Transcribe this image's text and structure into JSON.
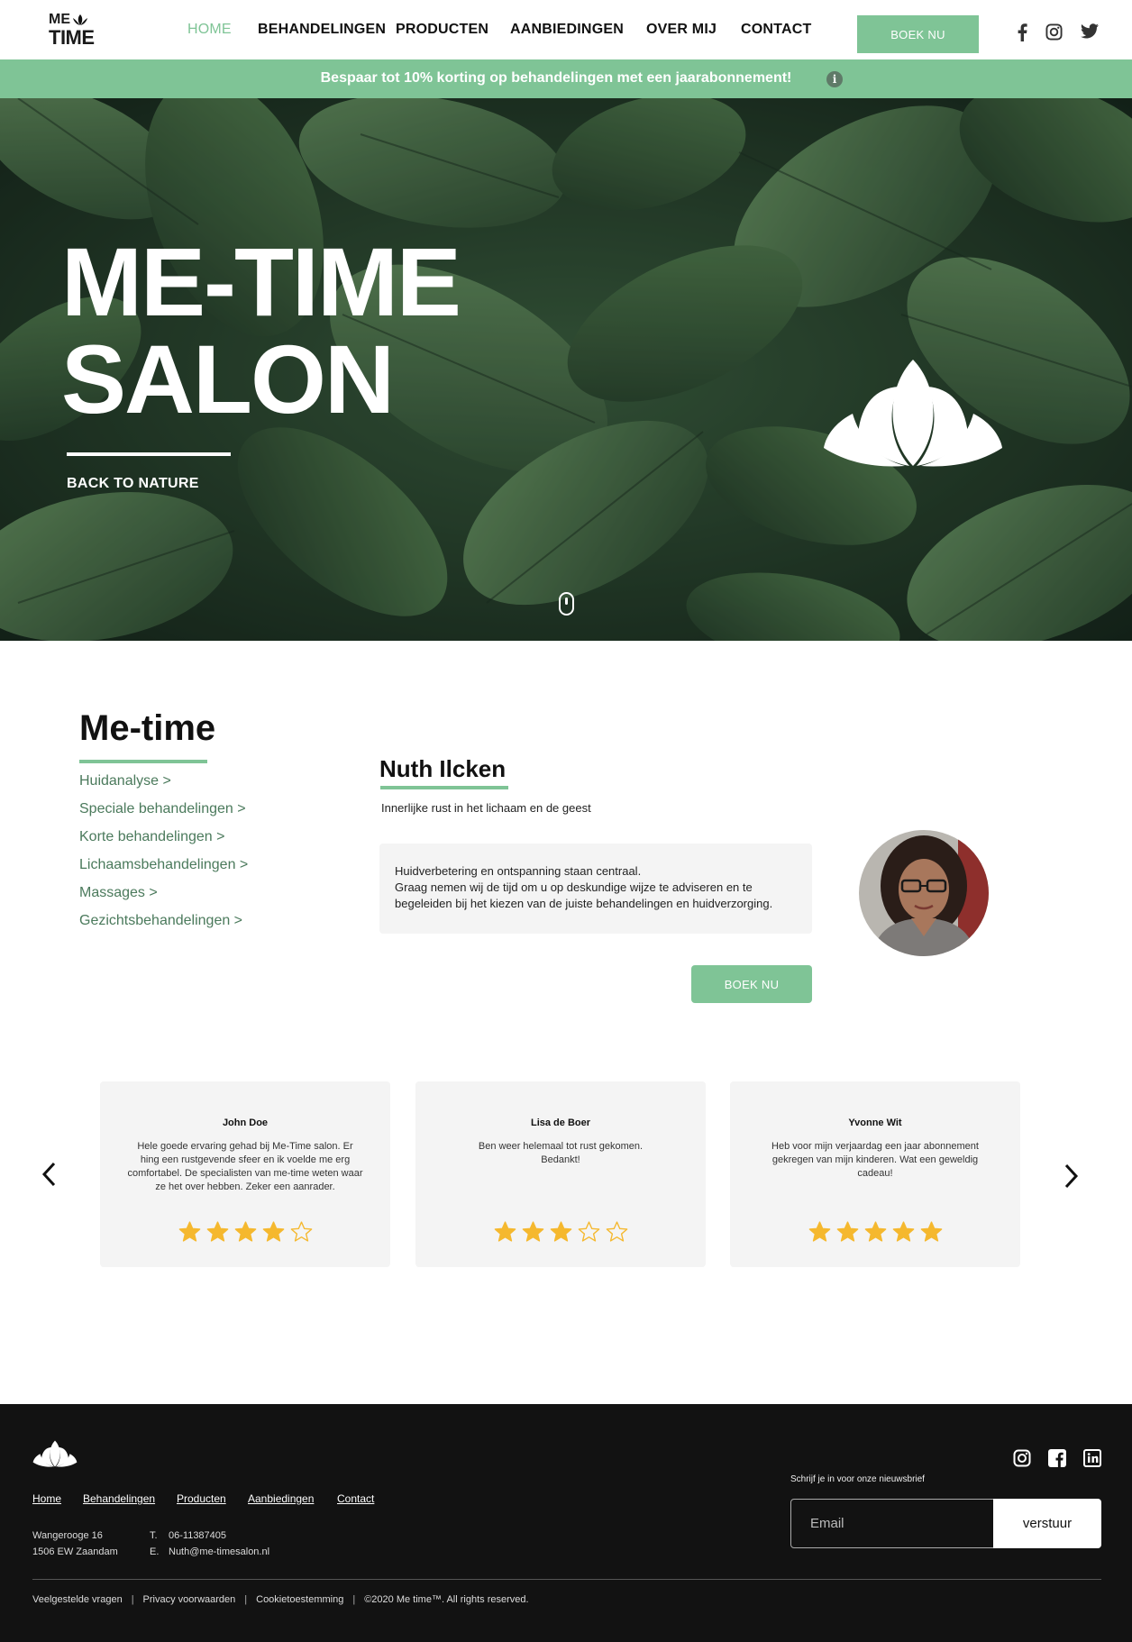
{
  "header": {
    "logo": {
      "line1": "ME",
      "line2": "TIME",
      "icon": "lotus-icon"
    },
    "nav": [
      {
        "label": "HOME",
        "active": true
      },
      {
        "label": "BEHANDELINGEN",
        "active": false
      },
      {
        "label": "PRODUCTEN",
        "active": false
      },
      {
        "label": "AANBIEDINGEN",
        "active": false
      },
      {
        "label": "OVER MIJ",
        "active": false
      },
      {
        "label": "CONTACT",
        "active": false
      }
    ],
    "book_label": "BOEK NU",
    "social_icons": [
      "facebook-icon",
      "instagram-icon",
      "twitter-icon"
    ]
  },
  "promo": {
    "text": "Bespaar tot 10% korting op behandelingen met een jaarabonnement!",
    "info_glyph": "i"
  },
  "hero": {
    "title_line1": "ME-TIME",
    "title_line2": "SALON",
    "tagline": "BACK TO NATURE",
    "icons": [
      "lotus-icon",
      "scroll-mouse-icon"
    ]
  },
  "metime": {
    "title": "Me-time",
    "categories": [
      "Huidanalyse  >",
      "Speciale behandelingen >",
      "Korte behandelingen >",
      "Lichaamsbehandelingen >",
      "Massages >",
      "Gezichtsbehandelingen  >"
    ]
  },
  "profile": {
    "name": "Nuth Ilcken",
    "subtitle": "Innerlijke rust in het lichaam en de geest",
    "bio_line1": "Huidverbetering en ontspanning staan centraal.",
    "bio_line2": "Graag nemen wij de tijd om u op deskundige wijze te adviseren en te begeleiden bij het kiezen van de juiste behandelingen en huidverzorging.",
    "book_label": "BOEK NU"
  },
  "reviews": [
    {
      "name": "John Doe",
      "text": "Hele goede ervaring gehad bij Me-Time salon. Er hing een rustgevende sfeer en ik voelde me erg comfortabel. De specialisten van me-time weten waar ze het over hebben. Zeker een aanrader.",
      "rating": 4
    },
    {
      "name": "Lisa de Boer",
      "text": "Ben weer helemaal tot rust gekomen. Bedankt!",
      "rating": 3
    },
    {
      "name": "Yvonne Wit",
      "text": "Heb voor mijn verjaardag een jaar abonnement gekregen van mijn kinderen. Wat een geweldig cadeau!",
      "rating": 5
    }
  ],
  "footer": {
    "links": [
      "Home",
      "Behandelingen",
      "Producten",
      "Aanbiedingen",
      "Contact"
    ],
    "address_line1": "Wangerooge 16",
    "address_line2": "1506 EW Zaandam",
    "phone_label": "T.",
    "phone": "06-11387405",
    "email_label": "E.",
    "email": "Nuth@me-timesalon.nl",
    "newsletter_label": "Schrijf je in voor onze nieuwsbrief",
    "email_placeholder": "Email",
    "submit_label": "verstuur",
    "social_icons": [
      "instagram-icon",
      "facebook-icon",
      "linkedin-icon"
    ],
    "legal": {
      "faq": "Veelgestelde vragen",
      "privacy": "Privacy voorwaarden",
      "cookies": "Cookietoestemming",
      "copyright": "©2020 Me time™. All rights reserved."
    }
  },
  "colors": {
    "accent": "#7fc496",
    "category_link": "#4b7a5c",
    "footer_bg": "#121212",
    "card_bg": "#f4f4f4",
    "star": "#f5b82e"
  }
}
